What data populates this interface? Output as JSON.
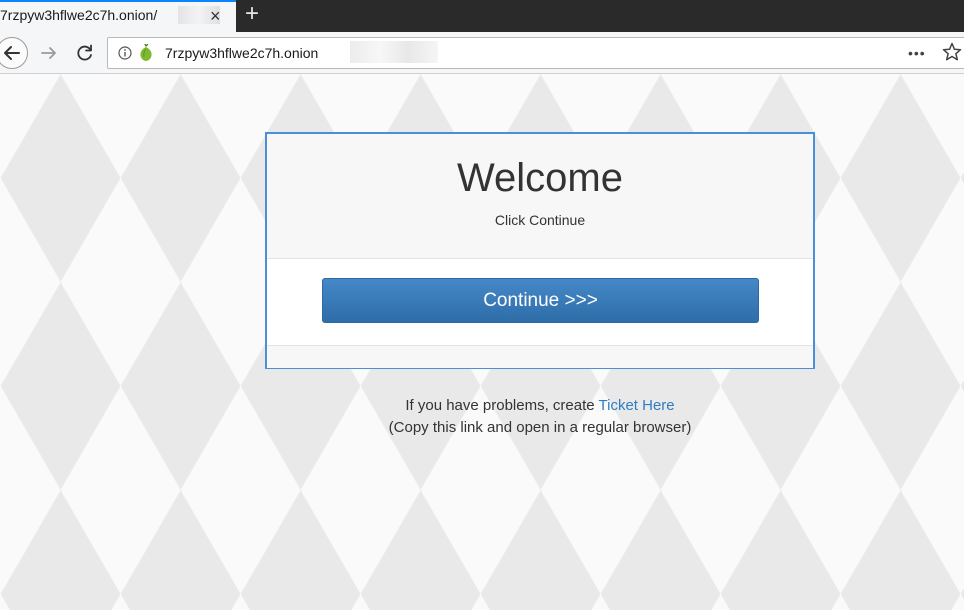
{
  "tab": {
    "title": "7rzpyw3hflwe2c7h.onion/",
    "close": "×",
    "new_tab": "+"
  },
  "address_bar": {
    "url": "7rzpyw3hflwe2c7h.onion",
    "more": "•••"
  },
  "page": {
    "heading": "Welcome",
    "subheading": "Click Continue",
    "continue_button": "Continue >>>",
    "problems_text": "If you have problems, create ",
    "ticket_link": "Ticket Here",
    "copy_note": "(Copy this link and open in a regular browser)"
  },
  "colors": {
    "accent": "#2d6ea8",
    "panel_border": "#4a90d9",
    "link": "#2f7dc2",
    "tab_bar": "#2b2a2a"
  },
  "icons": {
    "back": "back-arrow-icon",
    "forward": "forward-arrow-icon",
    "reload": "reload-icon",
    "info": "info-icon",
    "onion": "onion-icon",
    "more": "more-icon",
    "bookmark": "star-icon"
  }
}
